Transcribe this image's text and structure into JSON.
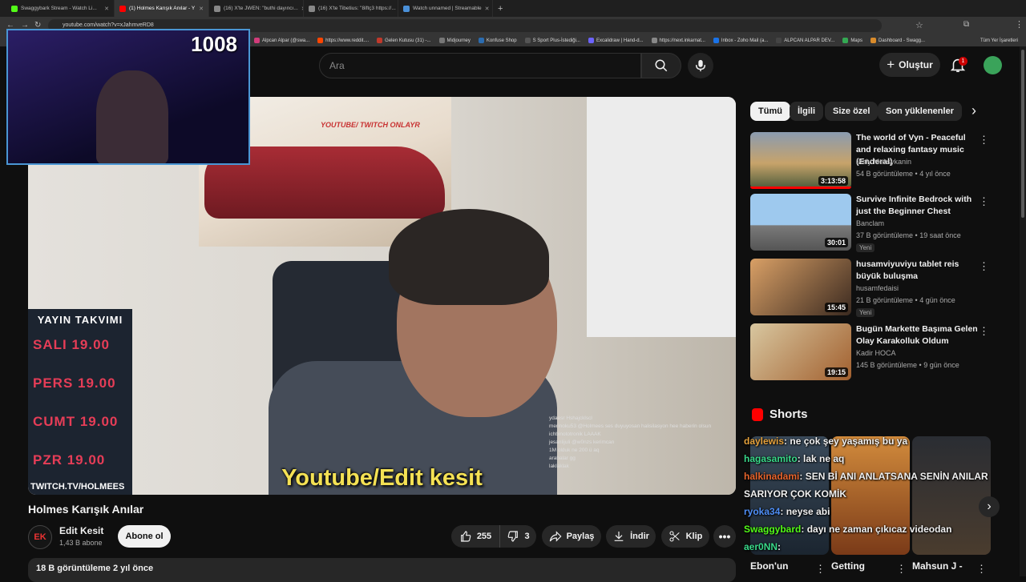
{
  "browser": {
    "tabs": [
      {
        "label": "Swaggybark Stream - Watch Li...",
        "color": "#53fc18"
      },
      {
        "label": "(1) Holmes Karışık Anılar - Y",
        "color": "#ff0000",
        "active": true
      },
      {
        "label": "(16) X'te JWEN: \"buthi dayıncı...",
        "color": "#888888"
      },
      {
        "label": "(16) X'te Tibetius: \"8iftç3 https://...",
        "color": "#888888"
      },
      {
        "label": "Watch unnamed | Streamable",
        "color": "#4a90d9"
      }
    ],
    "url": "youtube.com/watch?v=xJahmveRD8",
    "bookmarks": [
      "Alpcan Alpar (@swa...",
      "https://www.reddit....",
      "Gelen Kutusu (31) -...",
      "Midjourney",
      "Konfuse Shop",
      "S Sport Plus-İstediği...",
      "Excalidraw | Hand-d...",
      "https://next.inkarnat...",
      "Inbox - Zoho Mail (a...",
      "ALPCAN ALPAR DEV...",
      "Maps",
      "Dashboard - Swagg..."
    ],
    "all_bookmarks": "Tüm Yer İşaretleri"
  },
  "header": {
    "search_placeholder": "Ara",
    "create_label": "Oluştur",
    "notification_count": "1"
  },
  "webcam": {
    "viewer_count": "1008"
  },
  "video": {
    "poster_text": "YOUTUBE/ TWITCH ONLAYR",
    "schedule": {
      "title": "YAYIN TAKVIMI",
      "rows": [
        "SALI 19.00",
        "PERS 19.00",
        "CUMT 19.00",
        "PZR 19.00"
      ],
      "footer": "TWITCH.TV/HOLMEES"
    },
    "subtitle": "Youtube/Edit kesit",
    "overlay_chat": [
      "ydaesr Hshajcklscl",
      "merinoku53 @Holmees ses duyuyosan halisilasyon hee haberin olsun",
      "ichbinototronik LAAAK",
      "jesanlijuli @w0nzs kerimcan",
      "1M olduk ne 200 ü aq",
      "arabalar gg",
      "laklaklak"
    ]
  },
  "meta": {
    "title": "Holmes Karışık Anılar",
    "channel_initials": "EK",
    "channel_name": "Edit Kesit",
    "subscribers": "1,43 B abone",
    "subscribe_label": "Abone ol",
    "likes": "255",
    "dislikes": "3",
    "share_label": "Paylaş",
    "download_label": "İndir",
    "clip_label": "Klip",
    "views_line": "18 B görüntüleme  2 yıl önce"
  },
  "sidebar": {
    "chips": [
      "Tümü",
      "İlgili",
      "Size özel",
      "Son yüklenenler"
    ],
    "recommendations": [
      {
        "title": "The world of Vyn - Peaceful and relaxing fantasy music (Enderal)",
        "channel": "Mały Meksykanin",
        "meta": "54 B görüntüleme • 4 yıl önce",
        "duration": "3:13:58",
        "new": ""
      },
      {
        "title": "Survive Infinite Bedrock with just the Beginner Chest",
        "channel": "Banclam",
        "meta": "37 B görüntüleme • 19 saat önce",
        "duration": "30:01",
        "new": "Yeni"
      },
      {
        "title": "husamviyuviyu tablet reis büyük buluşma",
        "channel": "husamfedaisi",
        "meta": "21 B görüntüleme • 4 gün önce",
        "duration": "15:45",
        "new": "Yeni"
      },
      {
        "title": "Bugün Markette Başıma Gelen Olay Karakolluk Oldum",
        "channel": "Kadir HOCA",
        "meta": "145 B görüntüleme • 9 gün önce",
        "duration": "19:15",
        "new": ""
      }
    ],
    "shorts_title": "Shorts",
    "shorts": [
      "Ebon'un",
      "Getting",
      "Mahsun J -"
    ]
  },
  "chat_overlay": [
    {
      "user": "daylewis",
      "text": ": ne çok şey yaşamış bu ya",
      "color": "#e6a23c"
    },
    {
      "user": "hagasamito",
      "text": ": lak ne aq",
      "color": "#39d98a"
    },
    {
      "user": "halkinadami",
      "text": ": SEN Bİ ANI ANLATSANA SENİN ANILAR",
      "color": "#e8642c"
    },
    {
      "user": "",
      "text": "SARIYOR ÇOK KOMİK",
      "color": "#ffffff"
    },
    {
      "user": "ryoka34",
      "text": ": neyse abi",
      "color": "#4f8ff7"
    },
    {
      "user": "Swaggybard",
      "text": ": dayı ne zaman çıkıcaz videodan",
      "color": "#53fc18"
    },
    {
      "user": "aer0NN",
      "text": ":",
      "color": "#39d98a"
    }
  ],
  "colors": {
    "accent": "#ff0000",
    "background": "#0f0f0f",
    "webcam_border": "#4a96d4"
  }
}
